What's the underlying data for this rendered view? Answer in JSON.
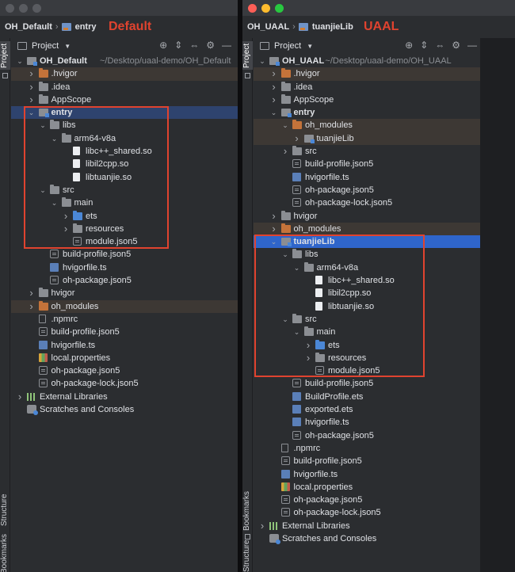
{
  "left": {
    "breadcrumb": [
      "OH_Default",
      "entry"
    ],
    "overlay_label": "Default",
    "side_tabs": {
      "project": "Project",
      "structure": "Structure",
      "bookmarks": "Bookmarks"
    },
    "panel_title": "Project",
    "tree": [
      {
        "depth": 0,
        "arrow": "down",
        "icon": "module",
        "label": "OH_Default",
        "suffix": "~/Desktop/uaal-demo/OH_Default",
        "bold": true
      },
      {
        "depth": 1,
        "arrow": "right",
        "icon": "folder-orange",
        "label": ".hvigor",
        "hl": "orange"
      },
      {
        "depth": 1,
        "arrow": "right",
        "icon": "folder",
        "label": ".idea"
      },
      {
        "depth": 1,
        "arrow": "right",
        "icon": "folder",
        "label": "AppScope"
      },
      {
        "depth": 1,
        "arrow": "down",
        "icon": "module",
        "label": "entry",
        "bold": true,
        "hl": "sel"
      },
      {
        "depth": 2,
        "arrow": "down",
        "icon": "folder",
        "label": "libs"
      },
      {
        "depth": 3,
        "arrow": "down",
        "icon": "folder",
        "label": "arm64-v8a"
      },
      {
        "depth": 4,
        "arrow": "",
        "icon": "file",
        "label": "libc++_shared.so"
      },
      {
        "depth": 4,
        "arrow": "",
        "icon": "file",
        "label": "libil2cpp.so"
      },
      {
        "depth": 4,
        "arrow": "",
        "icon": "file",
        "label": "libtuanjie.so"
      },
      {
        "depth": 2,
        "arrow": "down",
        "icon": "folder",
        "label": "src"
      },
      {
        "depth": 3,
        "arrow": "down",
        "icon": "folder",
        "label": "main"
      },
      {
        "depth": 4,
        "arrow": "right",
        "icon": "folder-blue",
        "label": "ets"
      },
      {
        "depth": 4,
        "arrow": "right",
        "icon": "folder",
        "label": "resources"
      },
      {
        "depth": 4,
        "arrow": "",
        "icon": "json",
        "label": "module.json5"
      },
      {
        "depth": 2,
        "arrow": "",
        "icon": "json",
        "label": "build-profile.json5"
      },
      {
        "depth": 2,
        "arrow": "",
        "icon": "ts",
        "label": "hvigorfile.ts"
      },
      {
        "depth": 2,
        "arrow": "",
        "icon": "json",
        "label": "oh-package.json5"
      },
      {
        "depth": 1,
        "arrow": "right",
        "icon": "folder",
        "label": "hvigor"
      },
      {
        "depth": 1,
        "arrow": "right",
        "icon": "folder-orange",
        "label": "oh_modules",
        "hl": "orange"
      },
      {
        "depth": 1,
        "arrow": "",
        "icon": "plain",
        "label": ".npmrc"
      },
      {
        "depth": 1,
        "arrow": "",
        "icon": "json",
        "label": "build-profile.json5"
      },
      {
        "depth": 1,
        "arrow": "",
        "icon": "ts",
        "label": "hvigorfile.ts"
      },
      {
        "depth": 1,
        "arrow": "",
        "icon": "props",
        "label": "local.properties"
      },
      {
        "depth": 1,
        "arrow": "",
        "icon": "json",
        "label": "oh-package.json5"
      },
      {
        "depth": 1,
        "arrow": "",
        "icon": "json",
        "label": "oh-package-lock.json5"
      },
      {
        "depth": 0,
        "arrow": "right",
        "icon": "lib",
        "label": "External Libraries"
      },
      {
        "depth": 0,
        "arrow": "",
        "icon": "scratch",
        "label": "Scratches and Consoles"
      }
    ]
  },
  "right": {
    "breadcrumb": [
      "OH_UAAL",
      "tuanjieLib"
    ],
    "overlay_label": "UAAL",
    "side_tabs": {
      "project": "Project",
      "bookmarks": "Bookmarks",
      "structure": "Structure"
    },
    "panel_title": "Project",
    "tree": [
      {
        "depth": 0,
        "arrow": "down",
        "icon": "module",
        "label": "OH_UAAL",
        "suffix": "~/Desktop/uaal-demo/OH_UAAL",
        "bold": true
      },
      {
        "depth": 1,
        "arrow": "right",
        "icon": "folder-orange",
        "label": ".hvigor",
        "hl": "orange"
      },
      {
        "depth": 1,
        "arrow": "right",
        "icon": "folder",
        "label": ".idea"
      },
      {
        "depth": 1,
        "arrow": "right",
        "icon": "folder",
        "label": "AppScope"
      },
      {
        "depth": 1,
        "arrow": "down",
        "icon": "module",
        "label": "entry",
        "bold": true
      },
      {
        "depth": 2,
        "arrow": "down",
        "icon": "folder-orange",
        "label": "oh_modules",
        "hl": "orange"
      },
      {
        "depth": 3,
        "arrow": "right",
        "icon": "module",
        "label": "tuanjieLib",
        "hl": "orange"
      },
      {
        "depth": 2,
        "arrow": "right",
        "icon": "folder",
        "label": "src"
      },
      {
        "depth": 2,
        "arrow": "",
        "icon": "json",
        "label": "build-profile.json5"
      },
      {
        "depth": 2,
        "arrow": "",
        "icon": "ts",
        "label": "hvigorfile.ts"
      },
      {
        "depth": 2,
        "arrow": "",
        "icon": "json",
        "label": "oh-package.json5"
      },
      {
        "depth": 2,
        "arrow": "",
        "icon": "json",
        "label": "oh-package-lock.json5"
      },
      {
        "depth": 1,
        "arrow": "right",
        "icon": "folder",
        "label": "hvigor"
      },
      {
        "depth": 1,
        "arrow": "right",
        "icon": "folder-orange",
        "label": "oh_modules",
        "hl": "orange"
      },
      {
        "depth": 1,
        "arrow": "down",
        "icon": "module",
        "label": "tuanjieLib",
        "bold": true,
        "hl": "sel-strong"
      },
      {
        "depth": 2,
        "arrow": "down",
        "icon": "folder",
        "label": "libs"
      },
      {
        "depth": 3,
        "arrow": "down",
        "icon": "folder",
        "label": "arm64-v8a"
      },
      {
        "depth": 4,
        "arrow": "",
        "icon": "file",
        "label": "libc++_shared.so"
      },
      {
        "depth": 4,
        "arrow": "",
        "icon": "file",
        "label": "libil2cpp.so"
      },
      {
        "depth": 4,
        "arrow": "",
        "icon": "file",
        "label": "libtuanjie.so"
      },
      {
        "depth": 2,
        "arrow": "down",
        "icon": "folder",
        "label": "src"
      },
      {
        "depth": 3,
        "arrow": "down",
        "icon": "folder",
        "label": "main"
      },
      {
        "depth": 4,
        "arrow": "right",
        "icon": "folder-blue",
        "label": "ets"
      },
      {
        "depth": 4,
        "arrow": "right",
        "icon": "folder",
        "label": "resources"
      },
      {
        "depth": 4,
        "arrow": "",
        "icon": "json",
        "label": "module.json5"
      },
      {
        "depth": 2,
        "arrow": "",
        "icon": "json",
        "label": "build-profile.json5"
      },
      {
        "depth": 2,
        "arrow": "",
        "icon": "ts",
        "label": "BuildProfile.ets"
      },
      {
        "depth": 2,
        "arrow": "",
        "icon": "ts",
        "label": "exported.ets"
      },
      {
        "depth": 2,
        "arrow": "",
        "icon": "ts",
        "label": "hvigorfile.ts"
      },
      {
        "depth": 2,
        "arrow": "",
        "icon": "json",
        "label": "oh-package.json5"
      },
      {
        "depth": 1,
        "arrow": "",
        "icon": "plain",
        "label": ".npmrc"
      },
      {
        "depth": 1,
        "arrow": "",
        "icon": "json",
        "label": "build-profile.json5"
      },
      {
        "depth": 1,
        "arrow": "",
        "icon": "ts",
        "label": "hvigorfile.ts"
      },
      {
        "depth": 1,
        "arrow": "",
        "icon": "props",
        "label": "local.properties"
      },
      {
        "depth": 1,
        "arrow": "",
        "icon": "json",
        "label": "oh-package.json5"
      },
      {
        "depth": 1,
        "arrow": "",
        "icon": "json",
        "label": "oh-package-lock.json5"
      },
      {
        "depth": 0,
        "arrow": "right",
        "icon": "lib",
        "label": "External Libraries"
      },
      {
        "depth": 0,
        "arrow": "",
        "icon": "scratch",
        "label": "Scratches and Consoles"
      }
    ]
  },
  "icons": {
    "gear": "gear-icon",
    "minimize": "minimize-icon",
    "expand": "expand-all-icon",
    "collapse": "collapse-all-icon",
    "locate": "locate-icon"
  },
  "colors": {
    "highlight_box": "#e0432f",
    "selection": "#2f65ca",
    "orange_folder": "#c4733a"
  }
}
